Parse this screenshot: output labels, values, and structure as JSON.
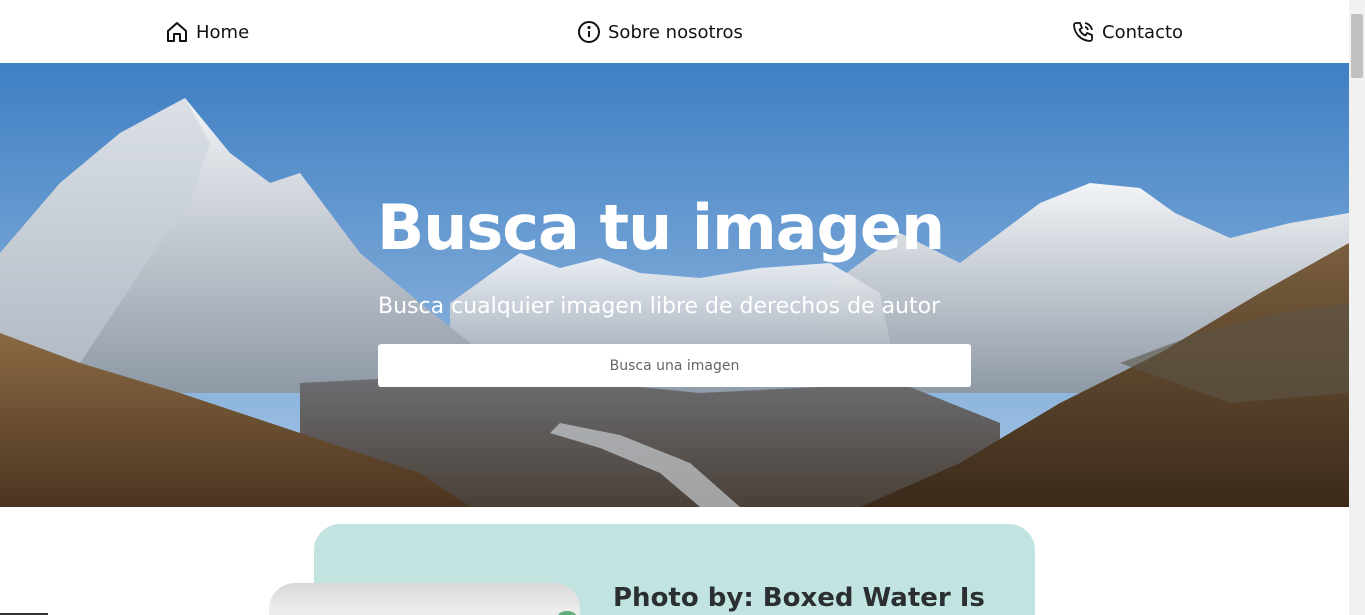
{
  "nav": {
    "items": [
      {
        "label": "Home",
        "icon": "home-icon"
      },
      {
        "label": "Sobre nosotros",
        "icon": "info-icon"
      },
      {
        "label": "Contacto",
        "icon": "phone-icon"
      }
    ]
  },
  "hero": {
    "title": "Busca tu imagen",
    "subtitle": "Busca cualquier imagen libre de derechos de autor",
    "search_placeholder": "Busca una imagen"
  },
  "card": {
    "title": "Photo by: Boxed Water Is"
  },
  "colors": {
    "card_bg": "#c2e4e0",
    "sky_top": "#4a86c8",
    "text_dark": "#2b2f33"
  }
}
